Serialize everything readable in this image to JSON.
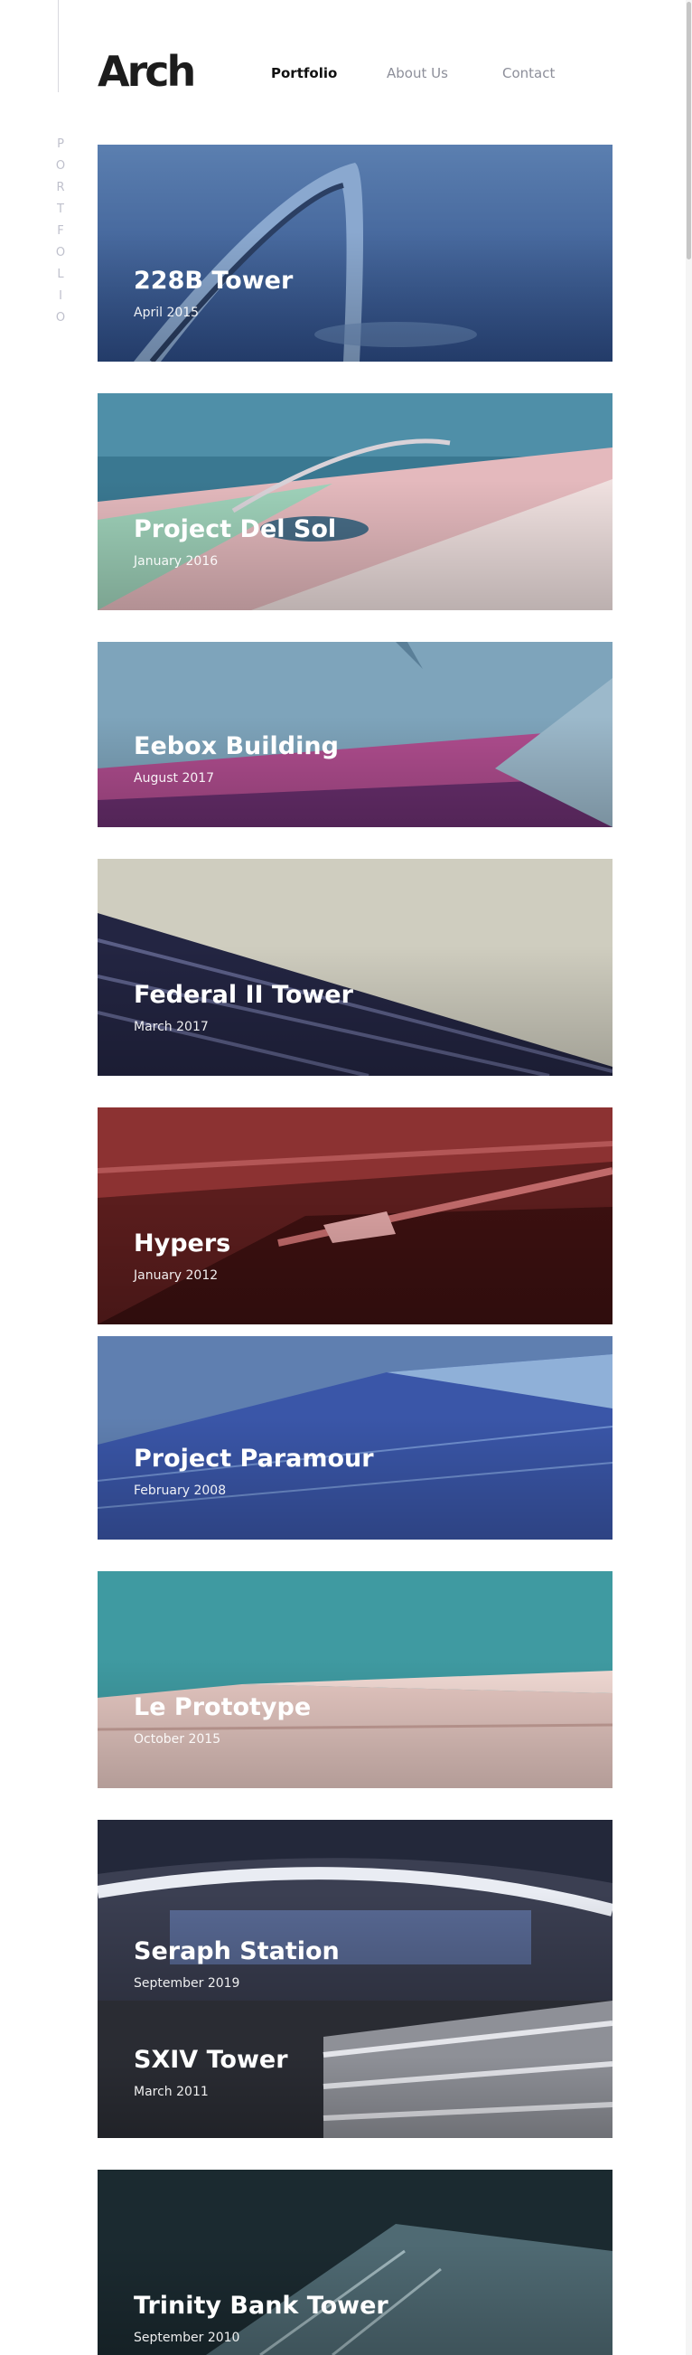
{
  "header": {
    "logo": "Arch",
    "nav": [
      {
        "label": "Portfolio",
        "active": true
      },
      {
        "label": "About Us",
        "active": false
      },
      {
        "label": "Contact",
        "active": false
      }
    ]
  },
  "side_label": [
    "P",
    "O",
    "R",
    "T",
    "F",
    "O",
    "L",
    "I",
    "O"
  ],
  "projects": [
    {
      "title": "228B Tower",
      "date": "April 2015"
    },
    {
      "title": "Project Del Sol",
      "date": "January 2016"
    },
    {
      "title": "Eebox Building",
      "date": "August 2017"
    },
    {
      "title": "Federal II Tower",
      "date": "March 2017"
    },
    {
      "title": "Hypers",
      "date": "January 2012"
    },
    {
      "title": "Project Paramour",
      "date": "February 2008"
    },
    {
      "title": "Le Prototype",
      "date": "October 2015"
    },
    {
      "title": "Seraph Station",
      "date": "September 2019"
    },
    {
      "title": "SXIV Tower",
      "date": "March 2011"
    },
    {
      "title": "Trinity Bank Tower",
      "date": "September 2010"
    }
  ]
}
